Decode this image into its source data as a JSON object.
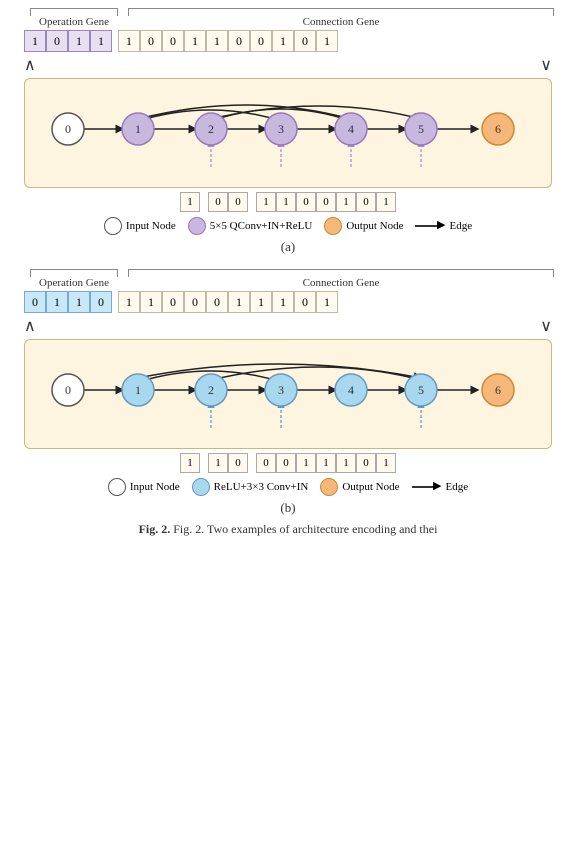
{
  "diagram_a": {
    "op_gene_label": "Operation Gene",
    "conn_gene_label": "Connection Gene",
    "op_cells": [
      "1",
      "0",
      "1",
      "1"
    ],
    "conn_cells": [
      "1",
      "0",
      "0",
      "1",
      "1",
      "0",
      "0",
      "1",
      "0",
      "1"
    ],
    "nodes": [
      {
        "id": "0",
        "type": "input"
      },
      {
        "id": "1",
        "type": "op_purple"
      },
      {
        "id": "2",
        "type": "op_purple"
      },
      {
        "id": "3",
        "type": "op_purple"
      },
      {
        "id": "4",
        "type": "op_purple"
      },
      {
        "id": "5",
        "type": "op_purple"
      },
      {
        "id": "6",
        "type": "output"
      }
    ],
    "sub_groups": [
      {
        "cells": [
          "1"
        ],
        "dashes": 1
      },
      {
        "cells": [
          "0",
          "0"
        ],
        "dashes": 2
      },
      {
        "cells": [
          "1",
          "1",
          "0",
          "0",
          "1",
          "0",
          "1"
        ],
        "dashes": 4
      }
    ],
    "legend": {
      "input_label": "Input Node",
      "op_label": "5×5 QConv+IN+ReLU",
      "output_label": "Output Node",
      "edge_label": "Edge"
    },
    "caption": "(a)"
  },
  "diagram_b": {
    "op_gene_label": "Operation Gene",
    "conn_gene_label": "Connection Gene",
    "op_cells": [
      "0",
      "1",
      "1",
      "0"
    ],
    "conn_cells": [
      "1",
      "1",
      "0",
      "0",
      "0",
      "1",
      "1",
      "1",
      "0",
      "1"
    ],
    "nodes": [
      {
        "id": "0",
        "type": "input"
      },
      {
        "id": "1",
        "type": "op_blue"
      },
      {
        "id": "2",
        "type": "op_blue"
      },
      {
        "id": "3",
        "type": "op_blue"
      },
      {
        "id": "4",
        "type": "op_blue"
      },
      {
        "id": "5",
        "type": "op_blue"
      },
      {
        "id": "6",
        "type": "output"
      }
    ],
    "sub_groups": [
      {
        "cells": [
          "1"
        ],
        "dashes": 1
      },
      {
        "cells": [
          "1",
          "0"
        ],
        "dashes": 2
      },
      {
        "cells": [
          "0",
          "0",
          "1",
          "1",
          "1",
          "0",
          "1"
        ],
        "dashes": 3
      }
    ],
    "legend": {
      "input_label": "Input Node",
      "op_label": "ReLU+3×3 Conv+IN",
      "output_label": "Output Node",
      "edge_label": "Edge"
    },
    "caption": "(b)"
  },
  "fig_caption": "Fig. 2. Two examples of architecture encoding and thei"
}
